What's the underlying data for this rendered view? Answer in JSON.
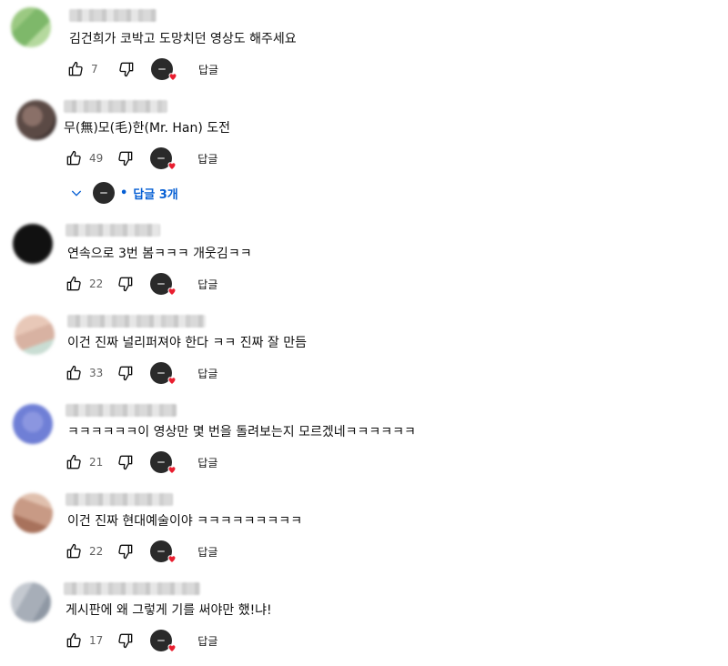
{
  "comments": [
    {
      "text": "김건희가 코박고 도망치던 영상도 해주세요",
      "likes": "7",
      "reply_label": "답글",
      "avatar_colors": [
        "#9bc982",
        "#7eb86a",
        "#b5d99e"
      ]
    },
    {
      "text": "무(無)모(毛)한(Mr. Han) 도전",
      "likes": "49",
      "reply_label": "답글",
      "avatar_colors": [
        "#5b4a45",
        "#8a7068",
        "#3e3230"
      ]
    },
    {
      "text": "연속으로 3번 봄ㅋㅋㅋ 개웃김ㅋㅋ",
      "likes": "22",
      "reply_label": "답글",
      "avatar_colors": [
        "#111111",
        "#222222",
        "#050505"
      ]
    },
    {
      "text": "이건 진짜 널리퍼져야 한다 ㅋㅋ 진짜 잘 만듬",
      "likes": "33",
      "reply_label": "답글",
      "avatar_colors": [
        "#e8c8b8",
        "#d8b2a2",
        "#c9ddd3"
      ]
    },
    {
      "text": "ㅋㅋㅋㅋㅋㅋ이 영상만 몇 번을 돌려보는지 모르겠네ㅋㅋㅋㅋㅋㅋ",
      "likes": "21",
      "reply_label": "답글",
      "avatar_colors": [
        "#6f7fd6",
        "#8b96e0",
        "#5a68c8"
      ]
    },
    {
      "text": "이건 진짜 현대예술이야 ㅋㅋㅋㅋㅋㅋㅋㅋㅋ",
      "likes": "22",
      "reply_label": "답글",
      "avatar_colors": [
        "#c89a85",
        "#a8725c",
        "#e0c0ae"
      ]
    },
    {
      "text": "게시판에 왜 그렇게 기를 써야만 했!냐!",
      "likes": "17",
      "reply_label": "답글",
      "avatar_colors": [
        "#a7aeb8",
        "#8f98a4",
        "#c4c9d0"
      ]
    }
  ],
  "replies_toggle": {
    "label": "답글 3개"
  },
  "colors": {
    "link": "#065fd4",
    "heart": "#e91e2f",
    "muted": "#606060"
  },
  "icons": {
    "like": "thumbs-up-icon",
    "dislike": "thumbs-down-icon",
    "heart": "heart-icon",
    "expand": "chevron-down-icon"
  }
}
